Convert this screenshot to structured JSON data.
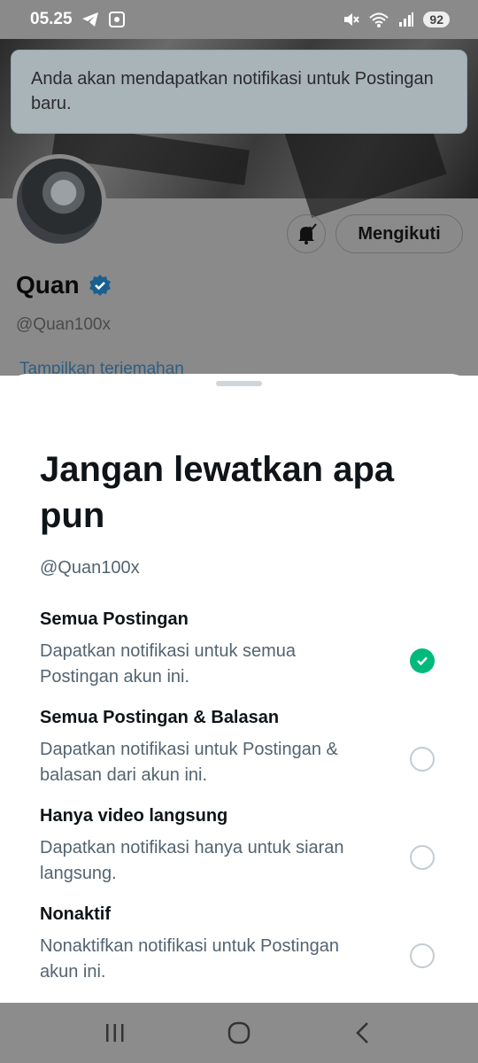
{
  "status": {
    "time": "05.25",
    "battery": "92",
    "icons": [
      "telegram-icon",
      "screenshot-icon",
      "mute-icon",
      "wifi-icon",
      "signal-icon"
    ]
  },
  "toast": {
    "text": "Anda akan mendapatkan notifikasi untuk Postingan baru."
  },
  "profile": {
    "name": "Quan",
    "handle": "@Quan100x",
    "follow_label": "Mengikuti",
    "peek_text": "Tampilkan terjemahan"
  },
  "sheet": {
    "title": "Jangan lewatkan apa pun",
    "handle": "@Quan100x",
    "options": [
      {
        "title": "Semua Postingan",
        "desc": "Dapatkan notifikasi untuk semua Postingan akun ini.",
        "selected": true
      },
      {
        "title": "Semua Postingan & Balasan",
        "desc": "Dapatkan notifikasi untuk Postingan & balasan dari akun ini.",
        "selected": false
      },
      {
        "title": "Hanya video langsung",
        "desc": "Dapatkan notifikasi hanya untuk siaran langsung.",
        "selected": false
      },
      {
        "title": "Nonaktif",
        "desc": "Nonaktifkan notifikasi untuk Postingan akun ini.",
        "selected": false
      }
    ]
  },
  "colors": {
    "accent": "#00ba7c",
    "verified": "#1d9bf0",
    "text_primary": "#0f1419",
    "text_secondary": "#536471"
  },
  "nav": [
    "recents-icon",
    "home-icon",
    "back-icon"
  ]
}
